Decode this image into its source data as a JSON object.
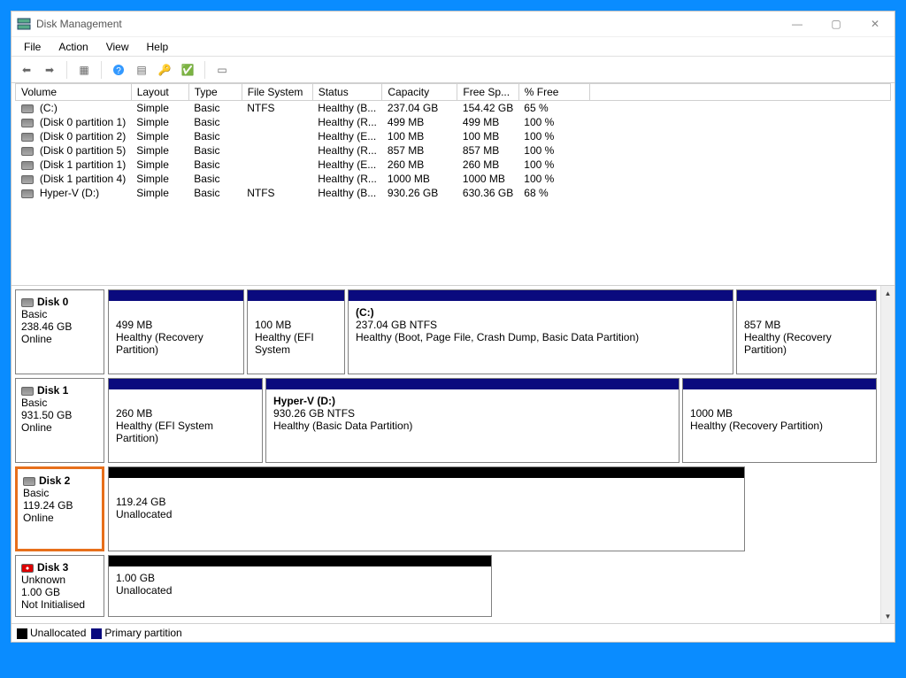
{
  "window": {
    "title": "Disk Management",
    "minimize": "—",
    "maximize": "▢",
    "close": "✕"
  },
  "menu": {
    "file": "File",
    "action": "Action",
    "view": "View",
    "help": "Help"
  },
  "table": {
    "headers": {
      "volume": "Volume",
      "layout": "Layout",
      "type": "Type",
      "filesystem": "File System",
      "status": "Status",
      "capacity": "Capacity",
      "freespace": "Free Sp...",
      "pctfree": "% Free"
    },
    "rows": [
      {
        "vol": " (C:)",
        "layout": "Simple",
        "type": "Basic",
        "fs": "NTFS",
        "status": "Healthy (B...",
        "cap": "237.04 GB",
        "free": "154.42 GB",
        "pct": "65 %"
      },
      {
        "vol": " (Disk 0 partition 1)",
        "layout": "Simple",
        "type": "Basic",
        "fs": "",
        "status": "Healthy (R...",
        "cap": "499 MB",
        "free": "499 MB",
        "pct": "100 %"
      },
      {
        "vol": " (Disk 0 partition 2)",
        "layout": "Simple",
        "type": "Basic",
        "fs": "",
        "status": "Healthy (E...",
        "cap": "100 MB",
        "free": "100 MB",
        "pct": "100 %"
      },
      {
        "vol": " (Disk 0 partition 5)",
        "layout": "Simple",
        "type": "Basic",
        "fs": "",
        "status": "Healthy (R...",
        "cap": "857 MB",
        "free": "857 MB",
        "pct": "100 %"
      },
      {
        "vol": " (Disk 1 partition 1)",
        "layout": "Simple",
        "type": "Basic",
        "fs": "",
        "status": "Healthy (E...",
        "cap": "260 MB",
        "free": "260 MB",
        "pct": "100 %"
      },
      {
        "vol": " (Disk 1 partition 4)",
        "layout": "Simple",
        "type": "Basic",
        "fs": "",
        "status": "Healthy (R...",
        "cap": "1000 MB",
        "free": "1000 MB",
        "pct": "100 %"
      },
      {
        "vol": " Hyper-V (D:)",
        "layout": "Simple",
        "type": "Basic",
        "fs": "NTFS",
        "status": "Healthy (B...",
        "cap": "930.26 GB",
        "free": "630.36 GB",
        "pct": "68 %"
      }
    ]
  },
  "disks": {
    "d0": {
      "name": "Disk 0",
      "type": "Basic",
      "size": "238.46 GB",
      "state": "Online"
    },
    "d0p1": {
      "size": "499 MB",
      "status": "Healthy (Recovery Partition)"
    },
    "d0p2": {
      "size": "100 MB",
      "status": "Healthy (EFI System"
    },
    "d0p3": {
      "title": " (C:)",
      "size": "237.04 GB NTFS",
      "status": "Healthy (Boot, Page File, Crash Dump, Basic Data Partition)"
    },
    "d0p4": {
      "size": "857 MB",
      "status": "Healthy (Recovery Partition)"
    },
    "d1": {
      "name": "Disk 1",
      "type": "Basic",
      "size": "931.50 GB",
      "state": "Online"
    },
    "d1p1": {
      "size": "260 MB",
      "status": "Healthy (EFI System Partition)"
    },
    "d1p2": {
      "title": "Hyper-V  (D:)",
      "size": "930.26 GB NTFS",
      "status": "Healthy (Basic Data Partition)"
    },
    "d1p3": {
      "size": "1000 MB",
      "status": "Healthy (Recovery Partition)"
    },
    "d2": {
      "name": "Disk 2",
      "type": "Basic",
      "size": "119.24 GB",
      "state": "Online"
    },
    "d2p1": {
      "size": "119.24 GB",
      "status": "Unallocated"
    },
    "d3": {
      "name": "Disk 3",
      "type": "Unknown",
      "size": "1.00 GB",
      "state": "Not Initialised"
    },
    "d3p1": {
      "size": "1.00 GB",
      "status": "Unallocated"
    }
  },
  "legend": {
    "unallocated": "Unallocated",
    "primary": "Primary partition"
  }
}
